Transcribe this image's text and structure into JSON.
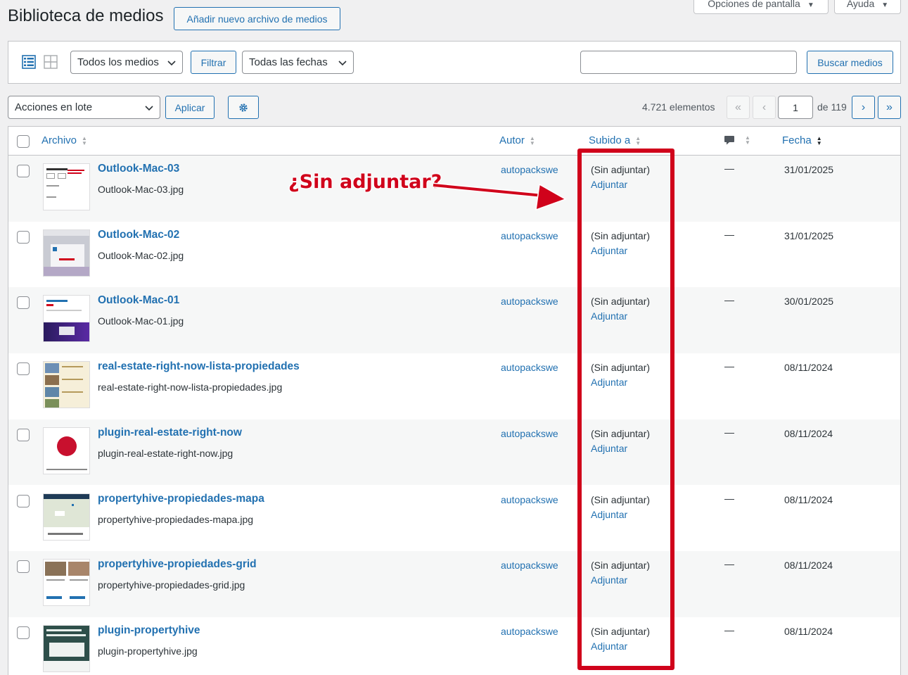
{
  "header": {
    "title": "Biblioteca de medios",
    "add_new": "Añadir nuevo archivo de medios",
    "screen_options": "Opciones de pantalla",
    "help": "Ayuda"
  },
  "filters": {
    "media_type": "Todos los medios",
    "filter_button": "Filtrar",
    "dates": "Todas las fechas",
    "search_value": "",
    "search_button": "Buscar medios"
  },
  "tablenav": {
    "bulk_actions": "Acciones en lote",
    "apply": "Aplicar",
    "item_count": "4.721 elementos",
    "current_page": "1",
    "total_pages": "de 119",
    "first": "«",
    "prev": "‹",
    "next": "›",
    "last": "»"
  },
  "columns": {
    "file": "Archivo",
    "author": "Autor",
    "uploaded_to": "Subido a",
    "date": "Fecha"
  },
  "rows": [
    {
      "title": "Outlook-Mac-03",
      "file": "Outlook-Mac-03.jpg",
      "author": "autopackswe",
      "uploaded": "(Sin adjuntar)",
      "attach": "Adjuntar",
      "comments": "—",
      "date": "31/01/2025"
    },
    {
      "title": "Outlook-Mac-02",
      "file": "Outlook-Mac-02.jpg",
      "author": "autopackswe",
      "uploaded": "(Sin adjuntar)",
      "attach": "Adjuntar",
      "comments": "—",
      "date": "31/01/2025"
    },
    {
      "title": "Outlook-Mac-01",
      "file": "Outlook-Mac-01.jpg",
      "author": "autopackswe",
      "uploaded": "(Sin adjuntar)",
      "attach": "Adjuntar",
      "comments": "—",
      "date": "30/01/2025"
    },
    {
      "title": "real-estate-right-now-lista-propiedades",
      "file": "real-estate-right-now-lista-propiedades.jpg",
      "author": "autopackswe",
      "uploaded": "(Sin adjuntar)",
      "attach": "Adjuntar",
      "comments": "—",
      "date": "08/11/2024"
    },
    {
      "title": "plugin-real-estate-right-now",
      "file": "plugin-real-estate-right-now.jpg",
      "author": "autopackswe",
      "uploaded": "(Sin adjuntar)",
      "attach": "Adjuntar",
      "comments": "—",
      "date": "08/11/2024"
    },
    {
      "title": "propertyhive-propiedades-mapa",
      "file": "propertyhive-propiedades-mapa.jpg",
      "author": "autopackswe",
      "uploaded": "(Sin adjuntar)",
      "attach": "Adjuntar",
      "comments": "—",
      "date": "08/11/2024"
    },
    {
      "title": "propertyhive-propiedades-grid",
      "file": "propertyhive-propiedades-grid.jpg",
      "author": "autopackswe",
      "uploaded": "(Sin adjuntar)",
      "attach": "Adjuntar",
      "comments": "—",
      "date": "08/11/2024"
    },
    {
      "title": "plugin-propertyhive",
      "file": "plugin-propertyhive.jpg",
      "author": "autopackswe",
      "uploaded": "(Sin adjuntar)",
      "attach": "Adjuntar",
      "comments": "—",
      "date": "08/11/2024"
    }
  ],
  "annotation": {
    "text": "¿Sin adjuntar?",
    "color": "#d0021b"
  },
  "colors": {
    "link": "#2271b1",
    "highlight": "#d0021b"
  }
}
